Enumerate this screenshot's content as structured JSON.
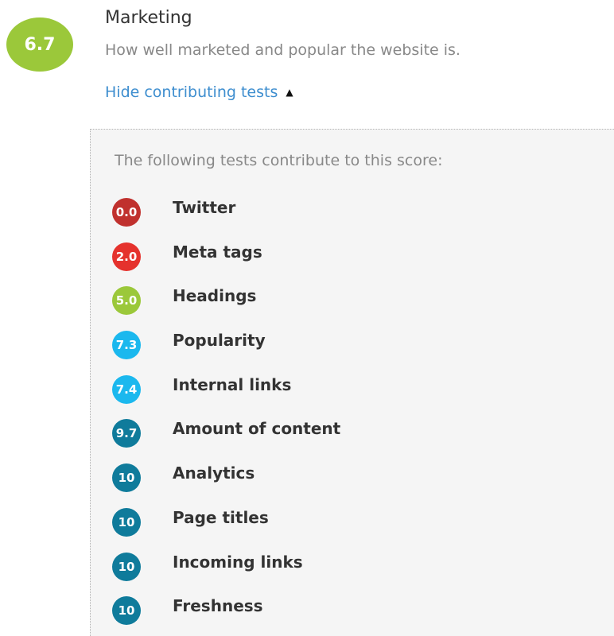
{
  "category": {
    "score": "6.7",
    "score_color": "#9bc83a",
    "title": "Marketing",
    "description": "How well marketed and popular the website is.",
    "toggle_label": "Hide contributing tests",
    "toggle_icon": "caret-up-icon",
    "toggle_state": "expanded"
  },
  "tests_panel": {
    "intro": "The following tests contribute to this score:",
    "tests": [
      {
        "score": "0.0",
        "name": "Twitter",
        "color": "#c0312e"
      },
      {
        "score": "2.0",
        "name": "Meta tags",
        "color": "#e5322d"
      },
      {
        "score": "5.0",
        "name": "Headings",
        "color": "#9bc83a"
      },
      {
        "score": "7.3",
        "name": "Popularity",
        "color": "#1bb8ee"
      },
      {
        "score": "7.4",
        "name": "Internal links",
        "color": "#1bb8ee"
      },
      {
        "score": "9.7",
        "name": "Amount of content",
        "color": "#0f7b9b"
      },
      {
        "score": "10",
        "name": "Analytics",
        "color": "#0f7b9b"
      },
      {
        "score": "10",
        "name": "Page titles",
        "color": "#0f7b9b"
      },
      {
        "score": "10",
        "name": "Incoming links",
        "color": "#0f7b9b"
      },
      {
        "score": "10",
        "name": "Freshness",
        "color": "#0f7b9b"
      }
    ]
  }
}
